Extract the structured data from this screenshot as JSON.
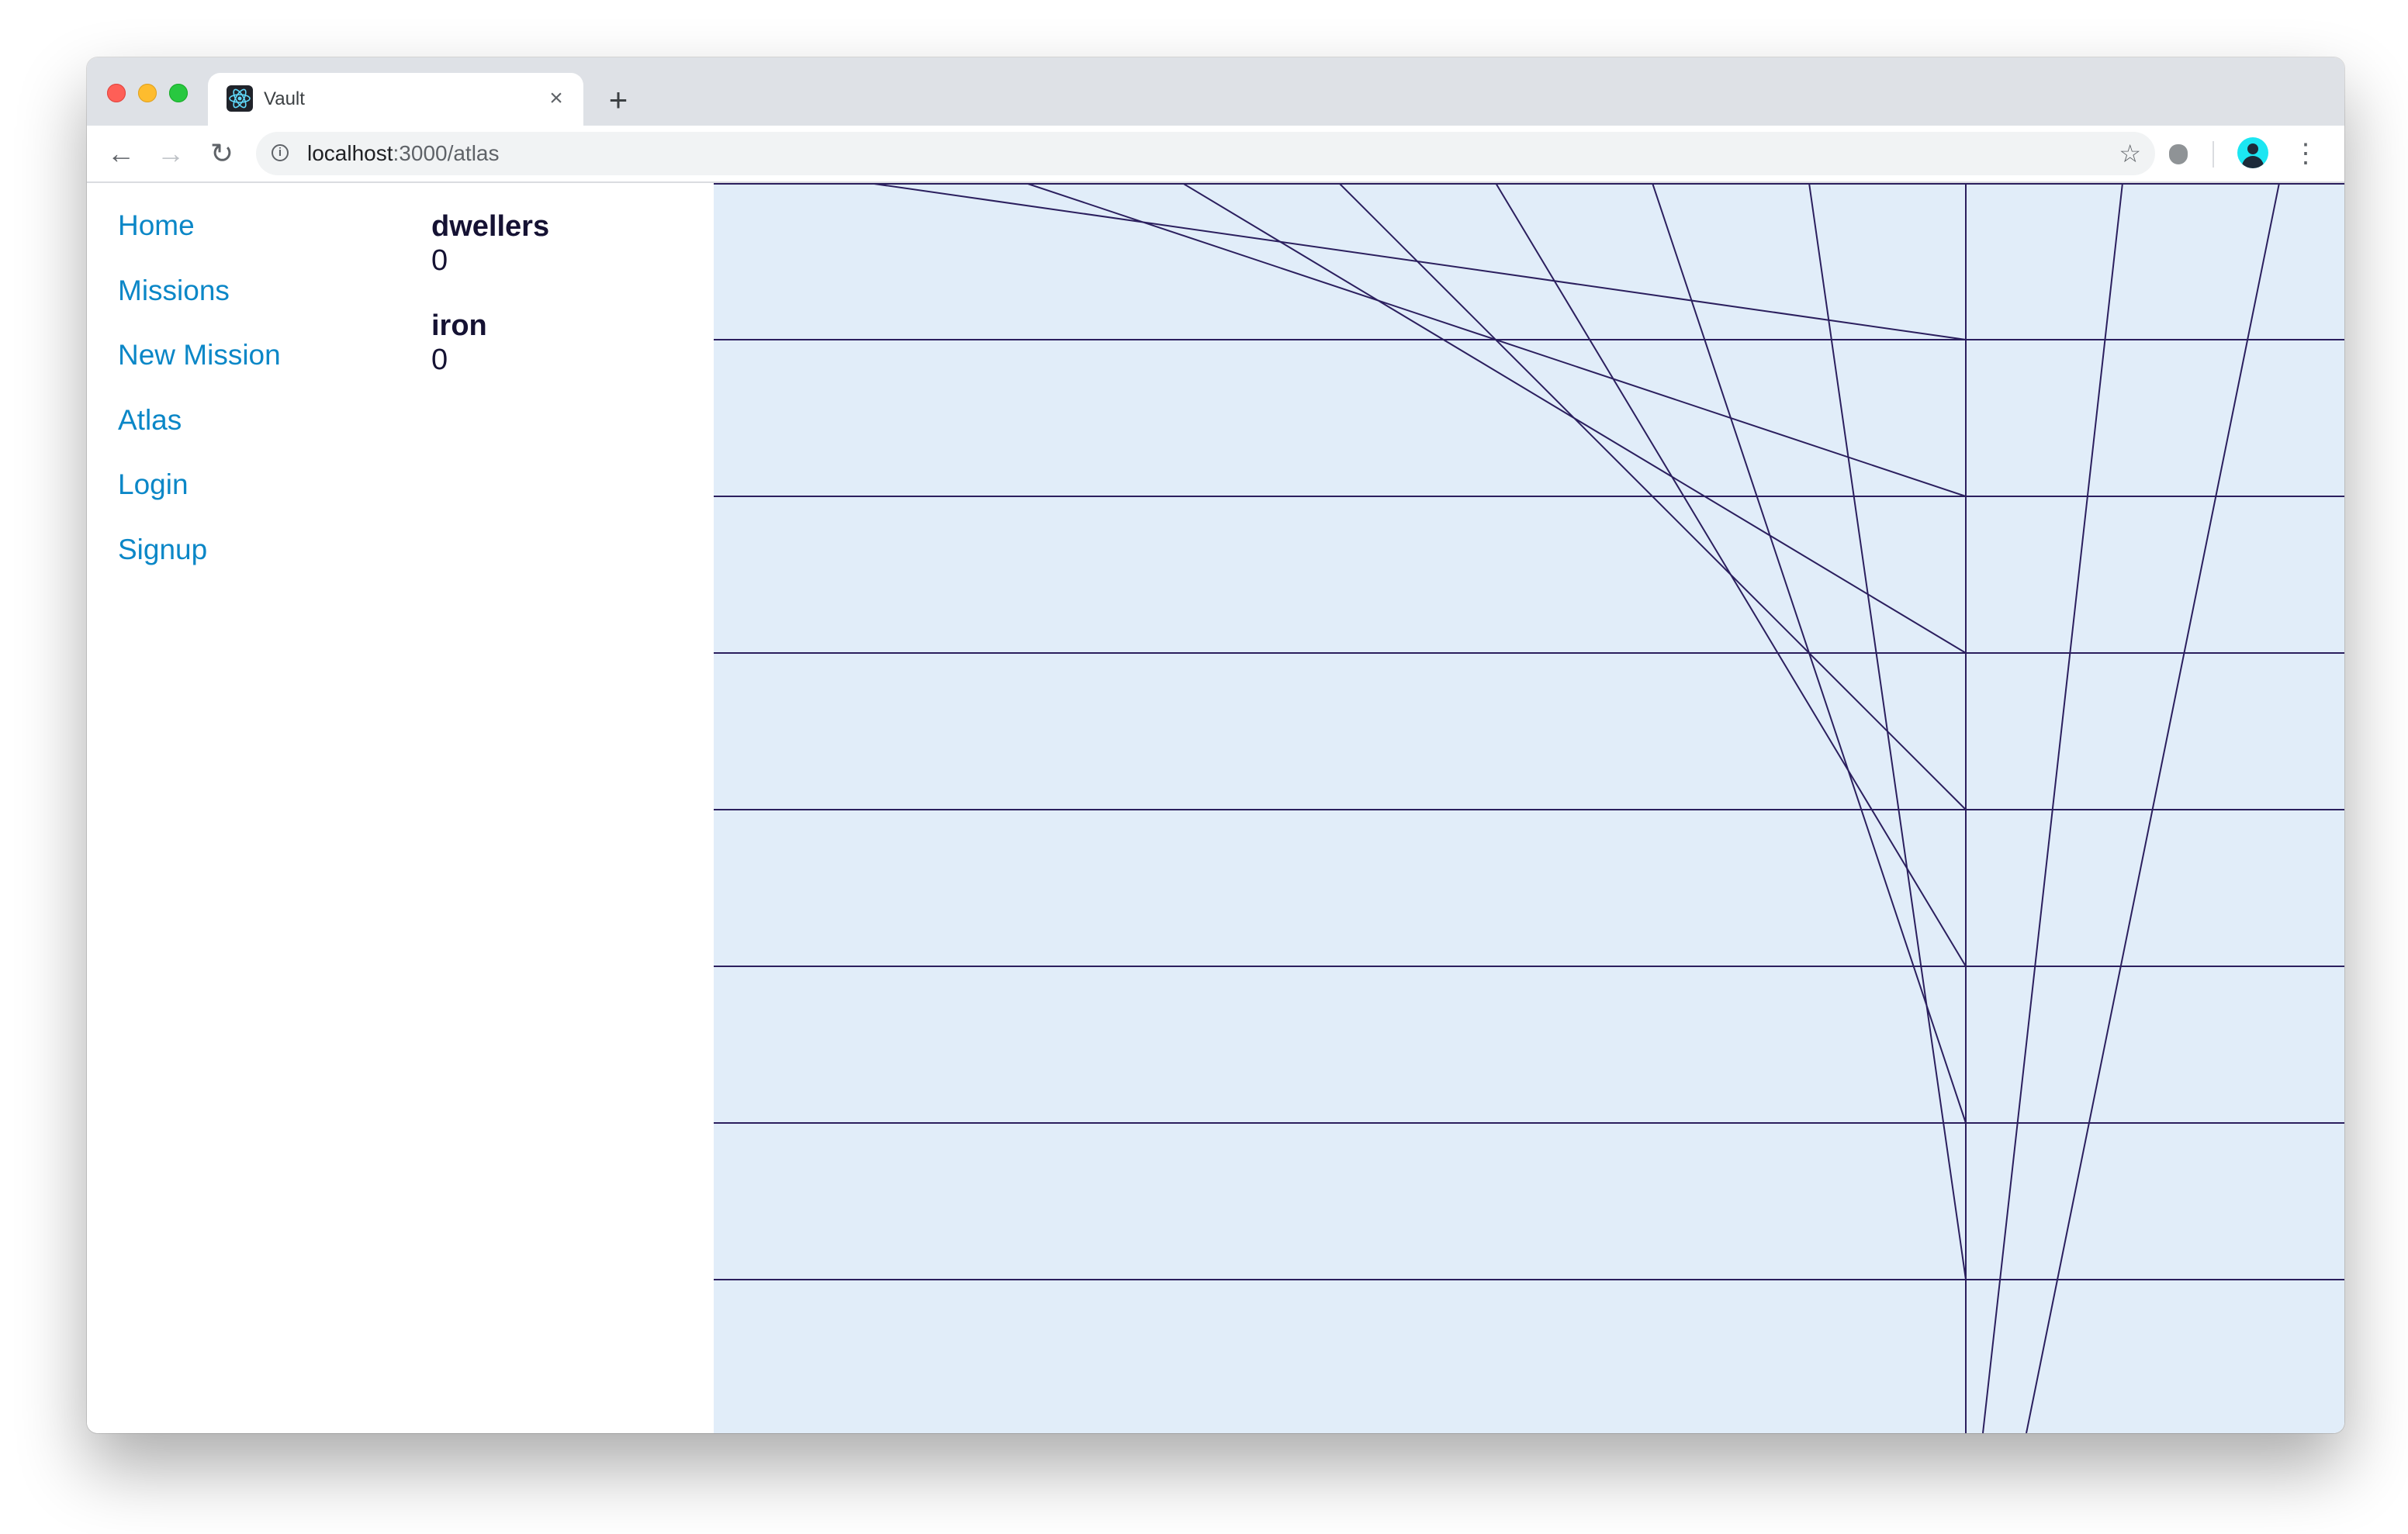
{
  "browser": {
    "tab": {
      "title": "Vault",
      "favicon": "react-atom-icon"
    },
    "new_tab_label": "+",
    "close_tab_label": "×",
    "address": {
      "host": "localhost",
      "path": ":3000/atlas"
    },
    "icons": {
      "back": "arrow-back-icon",
      "forward": "arrow-forward-icon",
      "reload": "reload-icon",
      "info": "info-icon",
      "bookmark": "star-icon",
      "extension": "bug-extension-icon",
      "profile": "avatar-icon",
      "menu": "kebab-menu-icon"
    }
  },
  "nav": {
    "items": [
      {
        "label": "Home"
      },
      {
        "label": "Missions"
      },
      {
        "label": "New Mission"
      },
      {
        "label": "Atlas"
      },
      {
        "label": "Login"
      },
      {
        "label": "Signup"
      }
    ]
  },
  "resources": [
    {
      "name": "dwellers",
      "value": "0"
    },
    {
      "name": "iron",
      "value": "0"
    }
  ],
  "colors": {
    "link": "#0b87c7",
    "text": "#151233",
    "atlas_background": "#e1edf9",
    "atlas_line": "#2b1f5e"
  }
}
